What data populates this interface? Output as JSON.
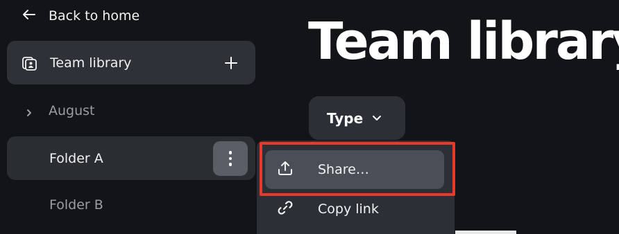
{
  "sidebar": {
    "back_label": "Back to home",
    "library_label": "Team library",
    "items": [
      {
        "label": "August"
      },
      {
        "label": "Folder A"
      },
      {
        "label": "Folder B"
      }
    ]
  },
  "main": {
    "title": "Team library",
    "filter_label": "Type"
  },
  "context_menu": {
    "items": [
      {
        "label": "Share…",
        "icon": "share-upload-icon"
      },
      {
        "label": "Copy link",
        "icon": "link-icon"
      }
    ]
  },
  "colors": {
    "background": "#131417",
    "panel": "#2e3137",
    "highlight": "#e8392a"
  }
}
